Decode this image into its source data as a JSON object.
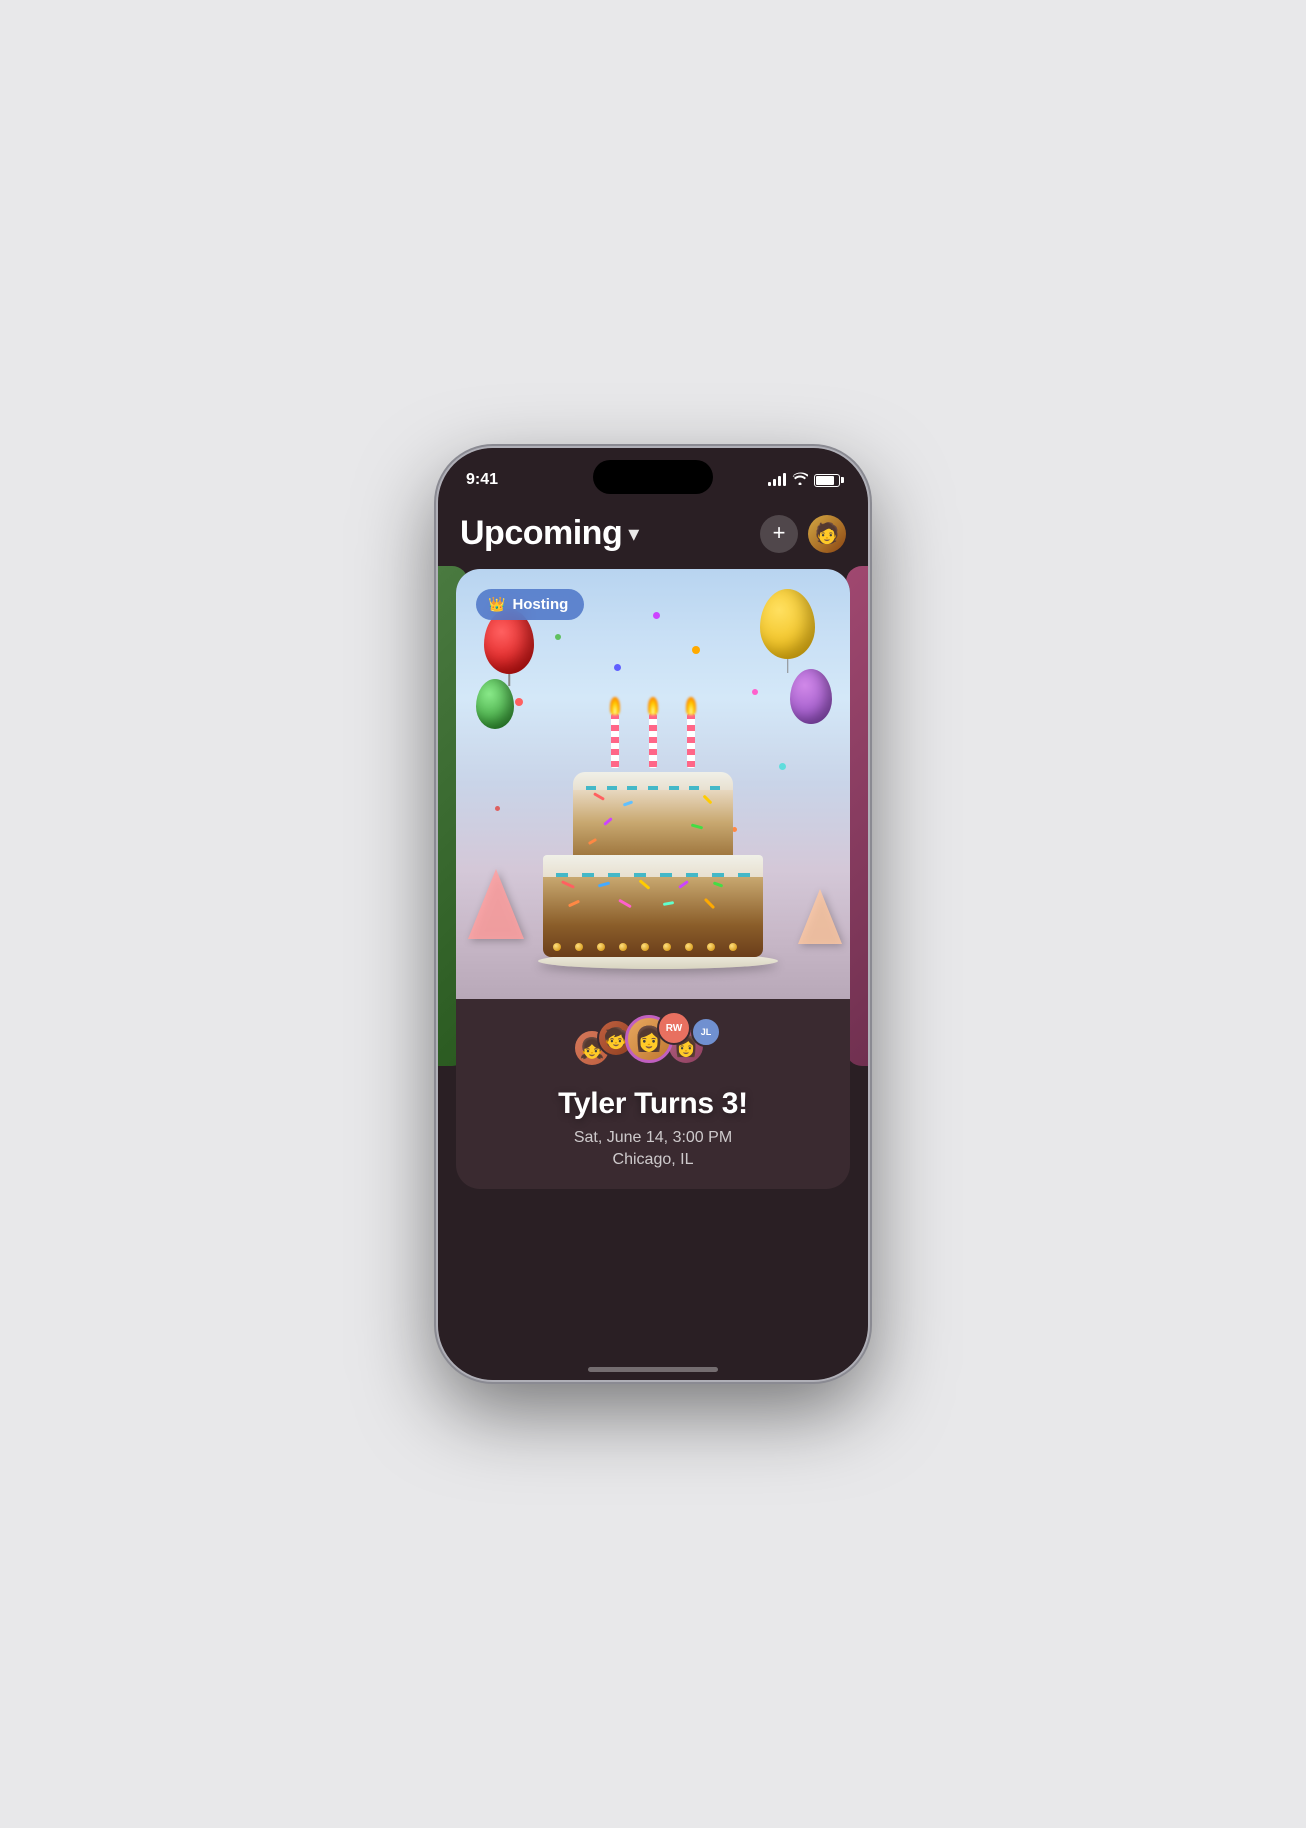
{
  "status_bar": {
    "time": "9:41",
    "signal_label": "signal",
    "wifi_label": "wifi",
    "battery_label": "battery"
  },
  "header": {
    "title": "Upcoming",
    "chevron": "▾",
    "add_button": "+",
    "avatar_emoji": "🧑"
  },
  "hosting_badge": {
    "crown": "👑",
    "label": "Hosting"
  },
  "event": {
    "title": "Tyler Turns 3!",
    "datetime": "Sat, June 14, 3:00 PM",
    "location": "Chicago, IL"
  },
  "attendees": [
    {
      "label": "A1",
      "color": "#d4785a",
      "initials": ""
    },
    {
      "label": "A2",
      "color": "#c06040",
      "initials": ""
    },
    {
      "label": "A3",
      "color": "#e8a860",
      "initials": ""
    },
    {
      "label": "A4",
      "color": "#b06080",
      "initials": ""
    },
    {
      "label": "RW",
      "color": "#e87060",
      "initials": "RW"
    },
    {
      "label": "JL",
      "color": "#7090d0",
      "initials": "JL"
    }
  ]
}
